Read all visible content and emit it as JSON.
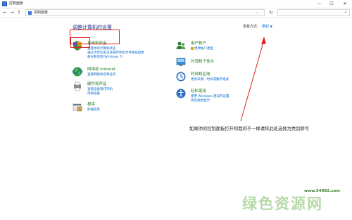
{
  "window": {
    "title": "控制面板",
    "min": "—",
    "max": "☐",
    "close": "✕"
  },
  "address": {
    "back": "←",
    "forward": "→",
    "up": "↑",
    "crumb": "控制面板",
    "chevron": "⌄",
    "refresh": "↻",
    "search_placeholder": "",
    "search_icon": "search-icon"
  },
  "main": {
    "title": "调整计算机的设置",
    "viewby_label": "查看方式:",
    "viewby_value": "类别",
    "viewby_caret": "▼"
  },
  "categories_left": [
    {
      "title": "系统和安全",
      "links": [
        "查看你的计算机状态",
        "通过文件历史记录保存你的文件备份副本",
        "备份和还原(Windows 7)"
      ],
      "icon": "shield-icon"
    },
    {
      "title": "网络和 Internet",
      "links": [
        "查看网络状态和任务"
      ],
      "icon": "network-globe-icon"
    },
    {
      "title": "硬件和声音",
      "links": [
        "查看设备和打印机",
        "添加设备"
      ],
      "icon": "printer-icon"
    },
    {
      "title": "程序",
      "links": [
        "卸载程序"
      ],
      "icon": "programs-icon"
    }
  ],
  "categories_right": [
    {
      "title": "用户帐户",
      "links": [
        "更改帐户类型"
      ],
      "icon": "users-icon"
    },
    {
      "title": "外观和个性化",
      "links": [],
      "icon": "appearance-icon"
    },
    {
      "title": "时钟和区域",
      "links": [
        "更改日期、时间或数字格式"
      ],
      "icon": "clock-icon"
    },
    {
      "title": "轻松使用",
      "links": [
        "使用 Windows 建议的设置",
        "优化视觉显示"
      ],
      "icon": "ease-of-access-icon"
    }
  ],
  "annotation": {
    "note": "如果你的控制面板打开和我的不一样请将此处选择为类别即可"
  },
  "watermark": {
    "text": "绿色资源网",
    "url": "www.54092.com"
  },
  "colors": {
    "title_blue": "#1e3287",
    "category_green": "#1e7a22",
    "link_blue": "#0066cc",
    "annotation_red": "#e02020"
  }
}
